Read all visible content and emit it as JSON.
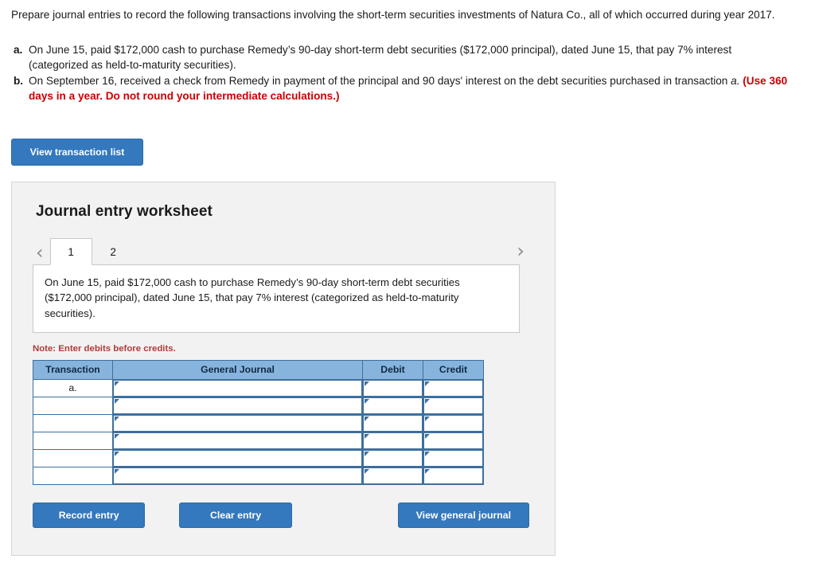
{
  "intro": "Prepare journal entries to record the following transactions involving the short-term securities investments of Natura Co., all of which occurred during year 2017.",
  "items": [
    {
      "label": "a.",
      "text": "On June 15, paid $172,000 cash to purchase Remedy’s 90-day short-term debt securities ($172,000 principal), dated June 15, that pay 7% interest (categorized as held-to-maturity securities)."
    },
    {
      "label": "b.",
      "text_before": "On September 16, received a check from Remedy in payment of the principal and 90 days' interest on the debt securities purchased in transaction ",
      "text_italic": "a.",
      "text_red": "(Use 360 days in a year. Do not round your intermediate calculations.)"
    }
  ],
  "view_transaction_list_label": "View transaction list",
  "worksheet": {
    "title": "Journal entry worksheet",
    "prev_arrow": "‹",
    "next_arrow": "›",
    "tabs": [
      {
        "label": "1",
        "active": true
      },
      {
        "label": "2",
        "active": false
      }
    ],
    "description": "On June 15, paid $172,000 cash to purchase Remedy’s 90-day short-term debt securities ($172,000 principal), dated June 15, that pay 7% interest (categorized as held-to-maturity securities).",
    "note": "Note: Enter debits before credits.",
    "table": {
      "headers": [
        "Transaction",
        "General Journal",
        "Debit",
        "Credit"
      ],
      "rows": [
        {
          "transaction": "a.",
          "general_journal": "",
          "debit": "",
          "credit": ""
        },
        {
          "transaction": "",
          "general_journal": "",
          "debit": "",
          "credit": ""
        },
        {
          "transaction": "",
          "general_journal": "",
          "debit": "",
          "credit": ""
        },
        {
          "transaction": "",
          "general_journal": "",
          "debit": "",
          "credit": ""
        },
        {
          "transaction": "",
          "general_journal": "",
          "debit": "",
          "credit": ""
        },
        {
          "transaction": "",
          "general_journal": "",
          "debit": "",
          "credit": ""
        }
      ]
    },
    "buttons": {
      "record": "Record entry",
      "clear": "Clear entry",
      "view_general_journal": "View general journal"
    }
  },
  "colors": {
    "button_blue": "#3478bd",
    "header_blue": "#87b4dd",
    "note_red": "#b33a3a",
    "emphasis_red": "#cc0000"
  }
}
